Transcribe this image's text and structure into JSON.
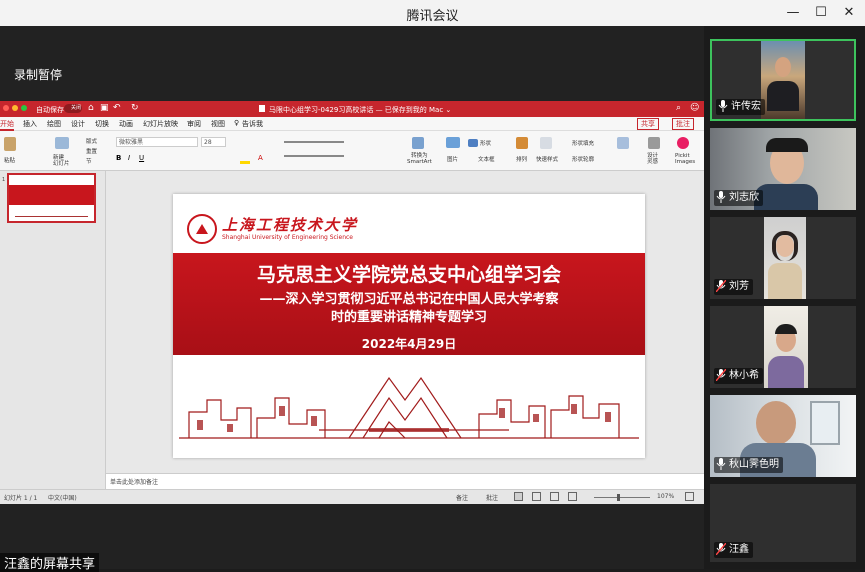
{
  "app": {
    "title": "腾讯会议",
    "recording_status": "录制暂停",
    "share_status": "汪鑫的屏幕共享"
  },
  "window_controls": {
    "minimize": "—",
    "maximize": "☐",
    "close": "✕"
  },
  "ppt": {
    "title": "马限中心组学习-0429习高校讲话 — 已保存到我的 Mac ⌄",
    "autosave": "自动保存",
    "autosave_state": "关闭",
    "tabs": [
      "开始",
      "插入",
      "绘图",
      "设计",
      "切换",
      "动画",
      "幻灯片放映",
      "审阅",
      "视图",
      "告诉我"
    ],
    "share_btn": "共享",
    "comment_btn": "批注",
    "font_name": "微软雅黑",
    "font_size": "28",
    "ribbon_labels": {
      "paste": "粘贴",
      "new_slide": "新建\n幻灯片",
      "layout": "版式",
      "reset": "重置",
      "section": "节",
      "convert": "转换为\nSmartArt",
      "picture": "图片",
      "shape": "形状",
      "textbox": "文本框",
      "arrange": "排列",
      "quick_style": "快速样式",
      "shape_fill": "形状填充",
      "shape_outline": "形状轮廓",
      "designer": "设计\n灵感",
      "pickit": "Pickit\nImages"
    },
    "notes_placeholder": "单击此处添加备注",
    "status": {
      "slide_count": "幻灯片 1 / 1",
      "language": "中文(中国)",
      "notes": "备注",
      "comments": "批注",
      "zoom": "107%"
    }
  },
  "slide": {
    "logo_cn": "上海工程技术大学",
    "logo_en": "Shanghai University of Engineering Science",
    "title": "马克思主义学院党总支中心组学习会",
    "subtitle_line1": "——深入学习贯彻习近平总书记在中国人民大学考察",
    "subtitle_line2": "时的重要讲话精神专题学习",
    "date": "2022年4月29日",
    "colors": {
      "banner": "#c8161d",
      "banner_dark": "#8e0f14"
    }
  },
  "participants": [
    {
      "name": "许传宏",
      "mic": "on",
      "active": true
    },
    {
      "name": "刘志欣",
      "mic": "on",
      "active": false
    },
    {
      "name": "刘芳",
      "mic": "muted",
      "active": false
    },
    {
      "name": "林小希",
      "mic": "muted",
      "active": false
    },
    {
      "name": "秋山霁色明",
      "mic": "on",
      "active": false
    },
    {
      "name": "汪鑫",
      "mic": "muted",
      "active": false
    }
  ]
}
